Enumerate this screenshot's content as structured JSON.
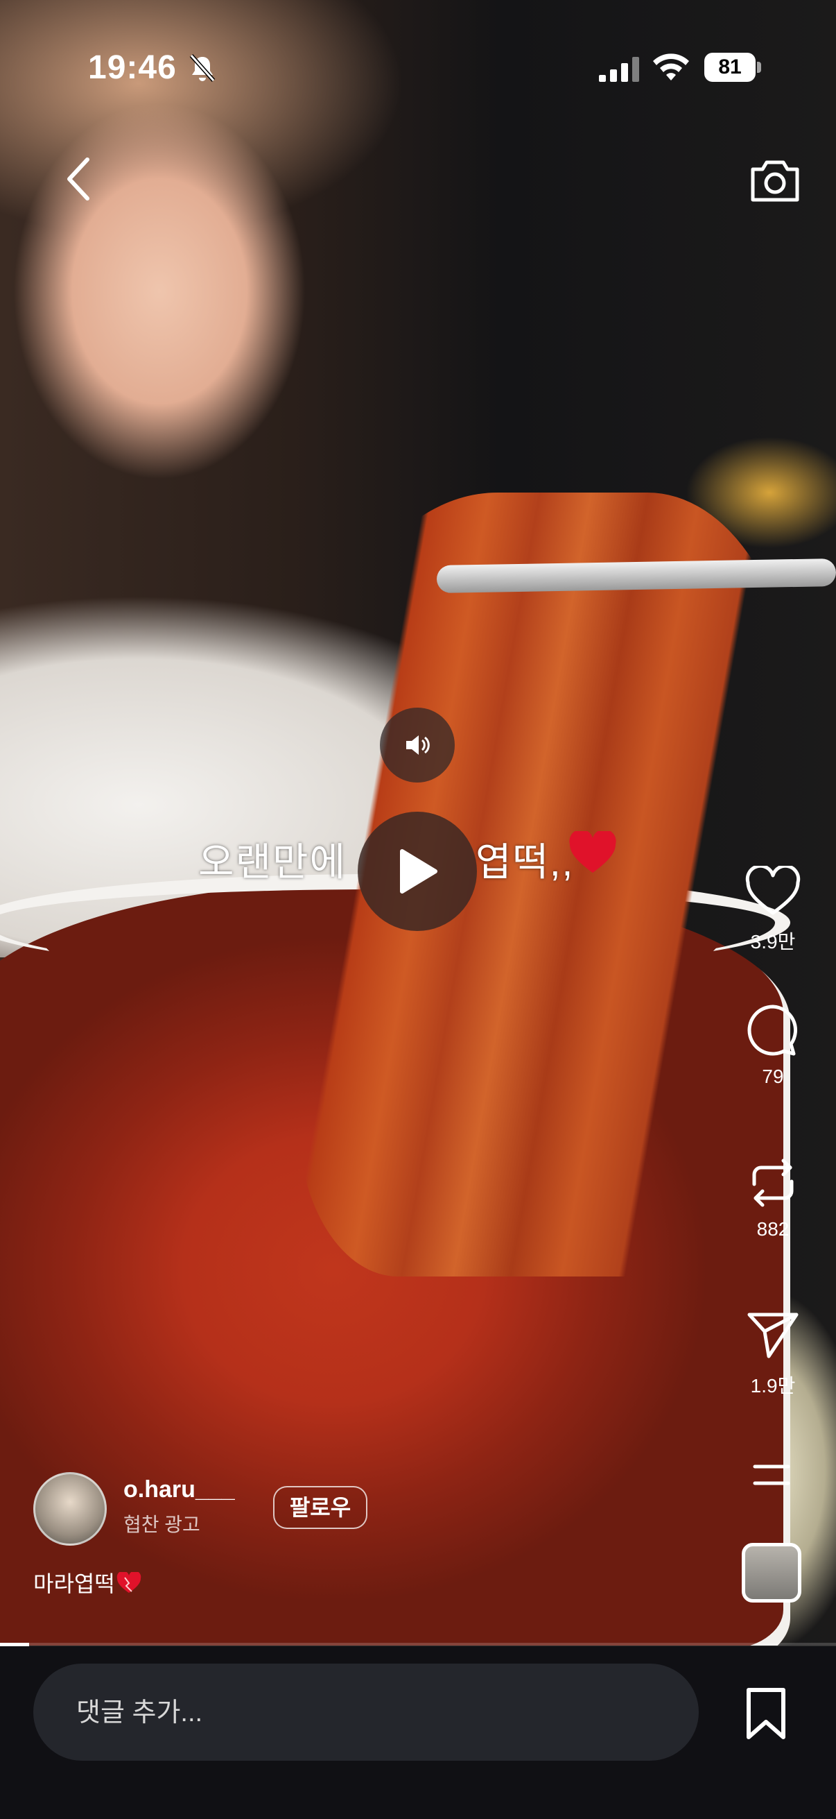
{
  "status_bar": {
    "time": "19:46",
    "battery": "81",
    "icons": [
      "bell-slash-icon",
      "cellular-signal-icon",
      "wifi-icon",
      "battery-icon"
    ]
  },
  "top_bar": {
    "back_icon": "chevron-left-icon",
    "camera_icon": "camera-icon"
  },
  "video": {
    "caption_part1": "오랜만에",
    "caption_part2": "엽떡,,",
    "caption_emoji": "red-heart-icon",
    "sound_icon": "speaker-icon",
    "play_icon": "play-icon",
    "progress": 0.035
  },
  "actions": {
    "like_count": "3.9만",
    "comment_count": "79",
    "repost_count": "882",
    "share_count": "1.9만"
  },
  "author": {
    "username": "o.haru___",
    "subtitle": "협찬 광고",
    "follow_label": "팔로우"
  },
  "description": {
    "text": "마라엽떡",
    "emoji": "heart-emoji"
  },
  "comment_bar": {
    "placeholder": "댓글 추가..."
  },
  "colors": {
    "bottom_bar": "#101014",
    "comment_field": "#24262c",
    "heart_red": "#e0122a"
  }
}
